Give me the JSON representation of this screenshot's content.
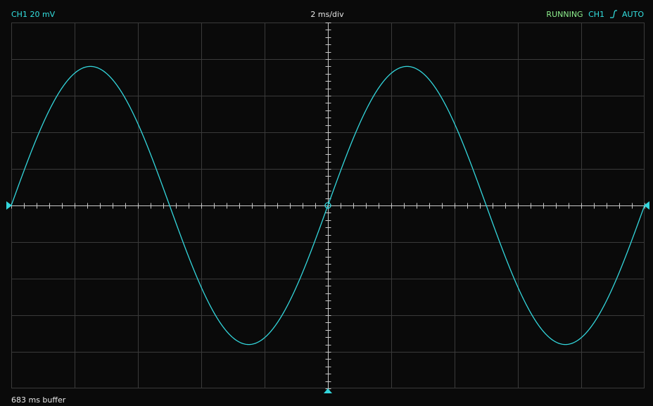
{
  "header": {
    "channel_scale": "CH1 20 mV",
    "timebase": "2 ms/div",
    "run_state": "RUNNING",
    "trigger_source": "CH1",
    "trigger_edge_icon": "rising-edge-icon",
    "trigger_mode": "AUTO"
  },
  "footer": {
    "buffer": "683 ms buffer"
  },
  "colors": {
    "background": "#0a0a0a",
    "grid": "#3a3a3a",
    "axis": "#c8c8c8",
    "trace": "#33d6dc",
    "run_state": "#8ef08e",
    "channel": "#33e0e0"
  },
  "chart_data": {
    "type": "line",
    "x_divisions": 10,
    "y_divisions": 10,
    "x_per_div": "2 ms",
    "y_per_div": "20 mV",
    "xlim": [
      -10,
      10
    ],
    "ylim": [
      -100,
      100
    ],
    "series": [
      {
        "shape": "sine",
        "amplitude": 76,
        "period": 10,
        "phase_zero_at_x": [
          -10,
          0,
          10
        ]
      }
    ]
  }
}
